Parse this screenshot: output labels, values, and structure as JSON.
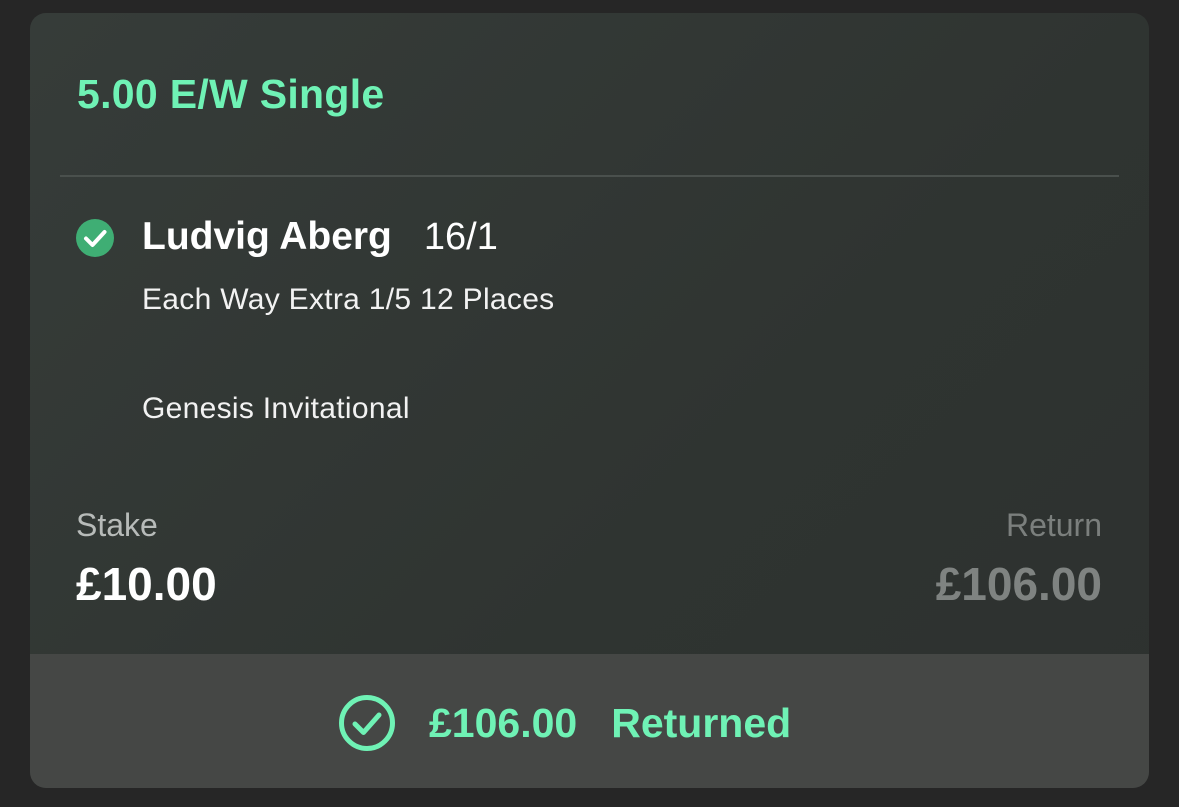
{
  "bet": {
    "type_label": "5.00 E/W Single",
    "selection": {
      "status_icon": "check-circle-filled-icon",
      "name": "Ludvig Aberg",
      "odds": "16/1",
      "market": "Each Way Extra 1/5 12 Places",
      "event": "Genesis Invitational"
    },
    "stake": {
      "label": "Stake",
      "value": "£10.00"
    },
    "return": {
      "label": "Return",
      "value": "£106.00"
    },
    "result": {
      "icon": "check-circle-outline-icon",
      "amount": "£106.00",
      "status": "Returned"
    }
  },
  "colors": {
    "accent": "#6ff2b5",
    "check_fill": "#3fae74",
    "card_bg": "#323734",
    "footer_bg": "#454745",
    "page_bg": "#262626"
  }
}
